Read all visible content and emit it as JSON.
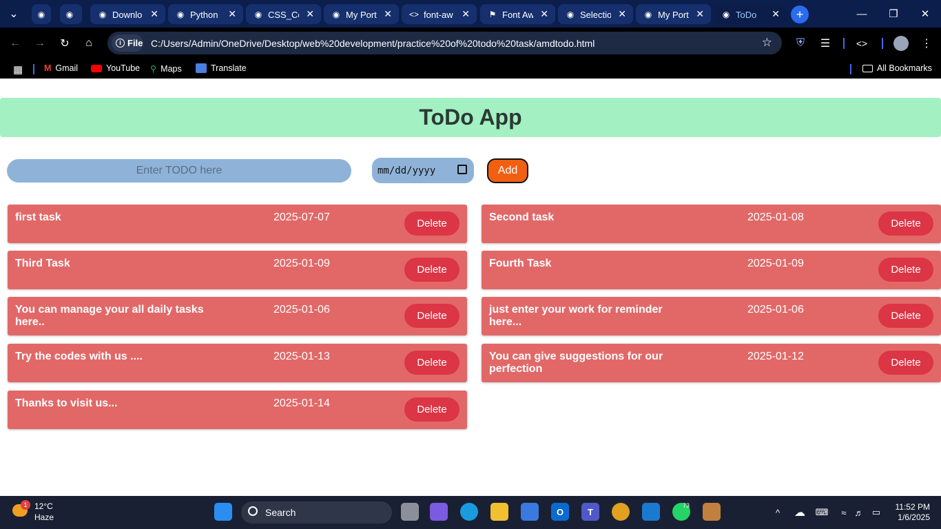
{
  "browser": {
    "tabs": [
      {
        "label": "",
        "icon": "profile-icon"
      },
      {
        "label": "",
        "icon": "openai-icon"
      },
      {
        "label": "Downlo",
        "icon": "globe-icon"
      },
      {
        "label": "Python",
        "icon": "globe-icon"
      },
      {
        "label": "CSS_Co",
        "icon": "globe-icon"
      },
      {
        "label": "My Port",
        "icon": "globe-icon"
      },
      {
        "label": "font-aw",
        "icon": "code-icon"
      },
      {
        "label": "Font Aw",
        "icon": "flag-icon"
      },
      {
        "label": "Selectio",
        "icon": "zoho-icon"
      },
      {
        "label": "My Port",
        "icon": "globe-icon"
      },
      {
        "label": "ToDo",
        "icon": "globe-icon"
      }
    ],
    "site_chip": "File",
    "url": "C:/Users/Admin/OneDrive/Desktop/web%20development/practice%20of%20todo%20task/amdtodo.html",
    "bookmarks": [
      "Gmail",
      "YouTube",
      "Maps",
      "Translate"
    ],
    "all_bookmarks": "All Bookmarks"
  },
  "app": {
    "title": "ToDo App",
    "input_placeholder": "Enter TODO here",
    "date_placeholder": "mm/dd/yyyy",
    "add_label": "Add",
    "delete_label": "Delete",
    "todos": [
      {
        "text": "first task",
        "date": "2025-07-07"
      },
      {
        "text": "Second task",
        "date": "2025-01-08"
      },
      {
        "text": "Third Task",
        "date": "2025-01-09"
      },
      {
        "text": "Fourth Task",
        "date": "2025-01-09"
      },
      {
        "text": "You can manage your all daily tasks here..",
        "date": "2025-01-06"
      },
      {
        "text": "just enter your work for reminder here...",
        "date": "2025-01-06"
      },
      {
        "text": "Try the codes with us ....",
        "date": "2025-01-13"
      },
      {
        "text": "You can give suggestions for our perfection",
        "date": "2025-01-12"
      },
      {
        "text": "Thanks to visit us...",
        "date": "2025-01-14"
      }
    ]
  },
  "taskbar": {
    "weather_temp": "12°C",
    "weather_desc": "Haze",
    "weather_badge": "1",
    "search_label": "Search",
    "whatsapp_badge": "73",
    "time": "11:52 PM",
    "date": "1/6/2025"
  },
  "colors": {
    "header_bg": "#a3f0c3",
    "card_bg": "#e26868",
    "delete_bg": "#dc3545",
    "add_bg": "#f06010",
    "input_bg": "#8fb3d8"
  }
}
